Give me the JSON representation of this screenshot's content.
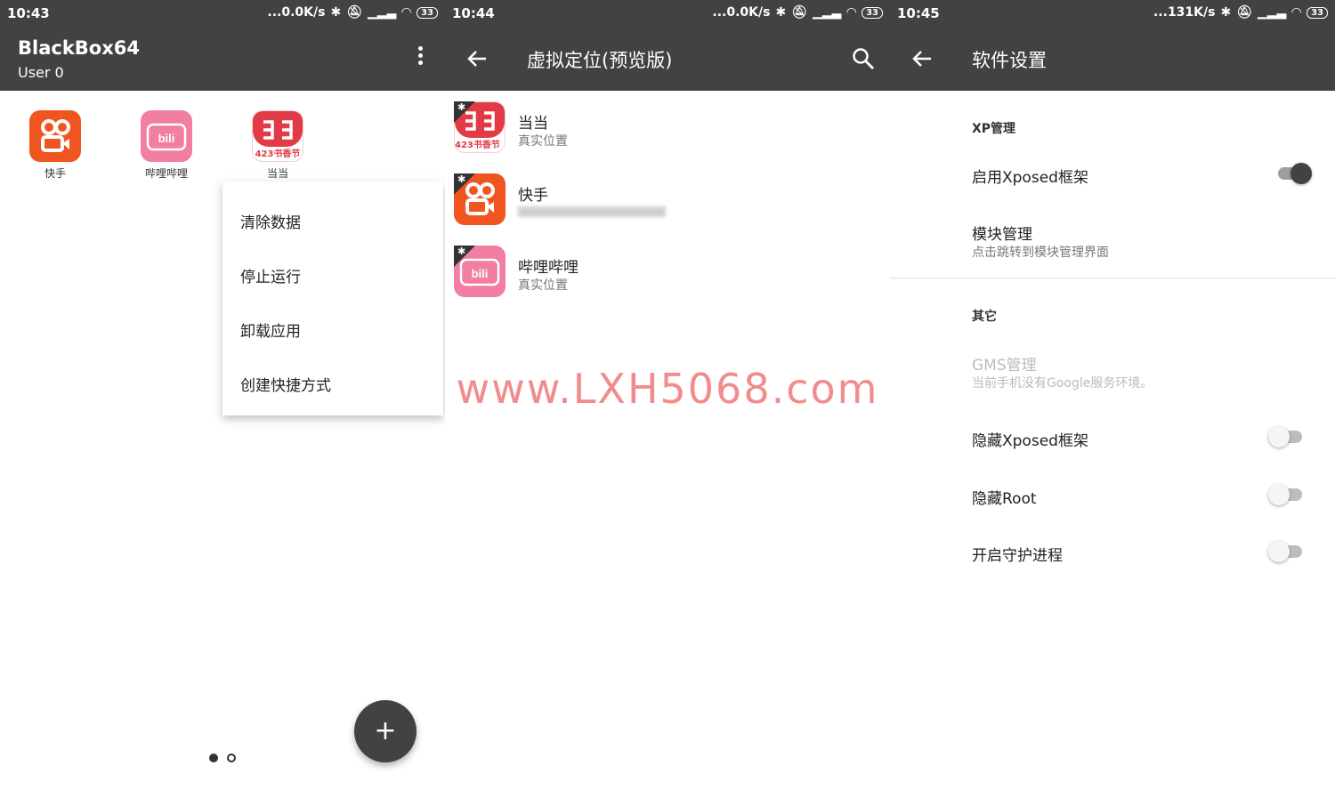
{
  "watermark": "www.LXH5068.com",
  "screen1": {
    "status": {
      "time": "10:43",
      "speed": "...0.0K/s",
      "battery": "33"
    },
    "appbar": {
      "title": "BlackBox64",
      "subtitle": "User 0"
    },
    "apps": [
      {
        "label": "快手",
        "icon": "kuaishou-icon"
      },
      {
        "label": "哔哩哔哩",
        "icon": "bilibili-icon"
      },
      {
        "label": "当当",
        "icon": "dangdang-icon",
        "badge_text": "423书香节"
      }
    ],
    "context_menu": [
      "清除数据",
      "停止运行",
      "卸载应用",
      "创建快捷方式"
    ],
    "fab_icon": "+"
  },
  "screen2": {
    "status": {
      "time": "10:44",
      "speed": "...0.0K/s",
      "battery": "33"
    },
    "appbar": {
      "title": "虚拟定位(预览版)"
    },
    "rows": [
      {
        "name": "当当",
        "location": "真实位置",
        "badge_text": "423书香节"
      },
      {
        "name": "快手",
        "location": ""
      },
      {
        "name": "哔哩哔哩",
        "location": "真实位置"
      }
    ]
  },
  "screen3": {
    "status": {
      "time": "10:45",
      "speed": "...131K/s",
      "battery": "33"
    },
    "appbar": {
      "title": "软件设置"
    },
    "section_xp": "XP管理",
    "enable_xposed": {
      "title": "启用Xposed框架",
      "on": true
    },
    "module_manage": {
      "title": "模块管理",
      "subtitle": "点击跳转到模块管理界面"
    },
    "section_other": "其它",
    "gms": {
      "title": "GMS管理",
      "subtitle": "当前手机没有Google服务环境。"
    },
    "hide_xposed": {
      "title": "隐藏Xposed框架",
      "on": false
    },
    "hide_root": {
      "title": "隐藏Root",
      "on": false
    },
    "daemon": {
      "title": "开启守护进程",
      "on": false
    }
  },
  "colors": {
    "appbar": "#424242",
    "kuaishou": "#f0541f",
    "bilibili": "#f27ea2",
    "dangdang": "#e23a46",
    "watermark": "#f08080"
  }
}
